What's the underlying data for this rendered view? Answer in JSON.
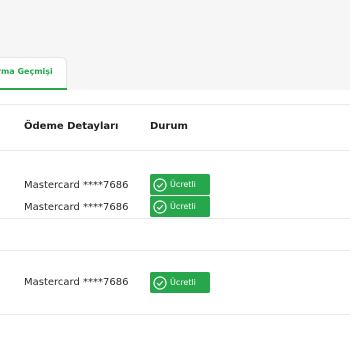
{
  "tabs": {
    "active_label": "rma Geçmişi"
  },
  "table": {
    "headers": {
      "payment": "Ödeme Detayları",
      "status": "Durum"
    },
    "rows": [
      {
        "payment": "Mastercard ****7686",
        "status": "Ücretli"
      },
      {
        "payment": "Mastercard ****7686",
        "status": "Ücretli"
      },
      {
        "payment": "Mastercard ****7686",
        "status": "Ücretli"
      }
    ]
  },
  "icons": {
    "status": "check-circle-icon"
  },
  "colors": {
    "accent": "#27a74b",
    "topbar": "#f6f6f6",
    "divider": "#e9e9e9"
  }
}
